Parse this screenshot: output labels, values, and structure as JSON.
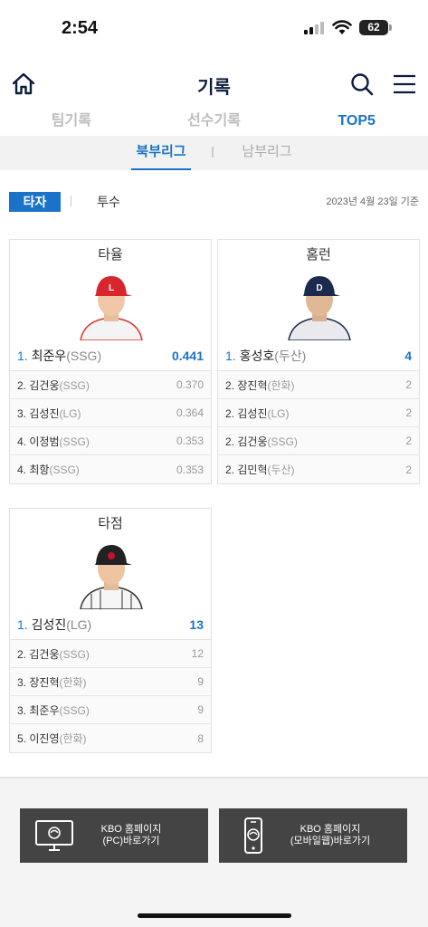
{
  "status_bar": {
    "time": "2:54",
    "battery": "62"
  },
  "header": {
    "title": "기록"
  },
  "main_tabs": [
    {
      "label": "팀기록"
    },
    {
      "label": "선수기록"
    },
    {
      "label": "TOP5"
    }
  ],
  "league_tabs": [
    {
      "label": "북부리그"
    },
    {
      "label": "남부리그"
    }
  ],
  "type_tabs": [
    {
      "label": "타자"
    },
    {
      "label": "투수"
    }
  ],
  "date_note": "2023년 4월 23일 기준",
  "cards": [
    {
      "title": "타율",
      "leader": {
        "rank": "1.",
        "name": "최준우",
        "team": "(SSG)",
        "value": "0.441"
      },
      "rows": [
        {
          "rank": "2.",
          "name": "김건웅",
          "team": "(SSG)",
          "value": "0.370"
        },
        {
          "rank": "3.",
          "name": "김성진",
          "team": "(LG)",
          "value": "0.364"
        },
        {
          "rank": "4.",
          "name": "이정범",
          "team": "(SSG)",
          "value": "0.353"
        },
        {
          "rank": "4.",
          "name": "최항",
          "team": "(SSG)",
          "value": "0.353"
        }
      ]
    },
    {
      "title": "홈런",
      "leader": {
        "rank": "1.",
        "name": "홍성호",
        "team": "(두산)",
        "value": "4"
      },
      "rows": [
        {
          "rank": "2.",
          "name": "장진혁",
          "team": "(한화)",
          "value": "2"
        },
        {
          "rank": "2.",
          "name": "김성진",
          "team": "(LG)",
          "value": "2"
        },
        {
          "rank": "2.",
          "name": "김건웅",
          "team": "(SSG)",
          "value": "2"
        },
        {
          "rank": "2.",
          "name": "김민혁",
          "team": "(두산)",
          "value": "2"
        }
      ]
    },
    {
      "title": "타점",
      "leader": {
        "rank": "1.",
        "name": "김성진",
        "team": "(LG)",
        "value": "13"
      },
      "rows": [
        {
          "rank": "2.",
          "name": "김건웅",
          "team": "(SSG)",
          "value": "12"
        },
        {
          "rank": "3.",
          "name": "장진혁",
          "team": "(한화)",
          "value": "9"
        },
        {
          "rank": "3.",
          "name": "최준우",
          "team": "(SSG)",
          "value": "9"
        },
        {
          "rank": "5.",
          "name": "이진영",
          "team": "(한화)",
          "value": "8"
        }
      ]
    }
  ],
  "bottom_buttons": [
    {
      "label": "KBO 홈페이지\n(PC)바로가기"
    },
    {
      "label": "KBO 홈페이지\n(모바일웹)바로가기"
    }
  ],
  "colors": {
    "accent": "#1a73c8",
    "title": "#0c1c3e",
    "button_bg": "#444444"
  }
}
